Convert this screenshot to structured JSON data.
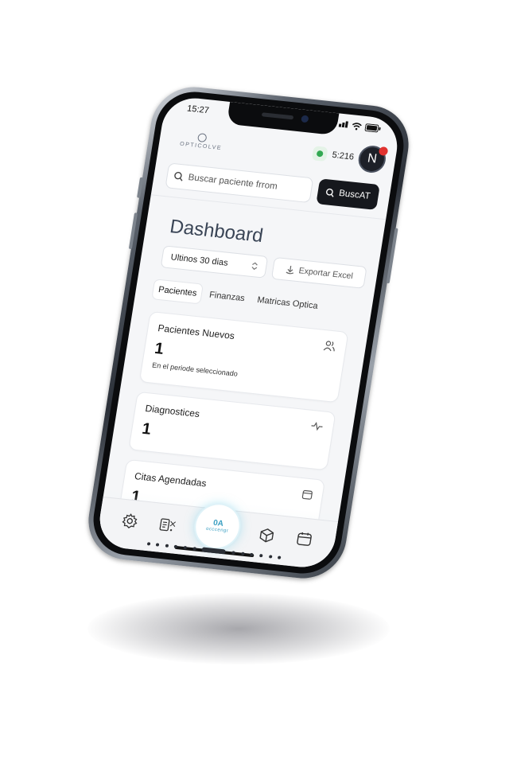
{
  "status_bar": {
    "time": "15:27"
  },
  "header": {
    "logo_text": "OPTICOLVE",
    "clock": "5:216",
    "avatar_initial": "N"
  },
  "search": {
    "placeholder": "Buscar paciente frrom",
    "button_label": "BuscAT"
  },
  "dashboard": {
    "title": "Dashboard",
    "period_select": "Ultinos 30 dias",
    "export_label": "Exportar Excel"
  },
  "tabs": [
    {
      "label": "Pacientes",
      "active": true
    },
    {
      "label": "Finanzas",
      "active": false
    },
    {
      "label": "Matricas Optica",
      "active": false
    }
  ],
  "cards": [
    {
      "title": "Pacientes Nuevos",
      "value": "1",
      "subtitle": "En el periode seleccionado",
      "icon": "users-icon"
    },
    {
      "title": "Diagnostices",
      "value": "1",
      "icon": "activity-icon"
    },
    {
      "title": "Citas Agendadas",
      "value": "1",
      "icon": "calendar-icon"
    }
  ],
  "bottom_nav": {
    "center_top": "0A",
    "center_bottom": "occcengr",
    "icons": [
      "gear-icon",
      "clipboard-icon",
      "center-action",
      "box-icon",
      "calendar-icon"
    ]
  },
  "colors": {
    "accent_dark": "#16181d",
    "online_green": "#32a852",
    "badge_red": "#e0322f",
    "center_glow": "#3a9fc2"
  }
}
